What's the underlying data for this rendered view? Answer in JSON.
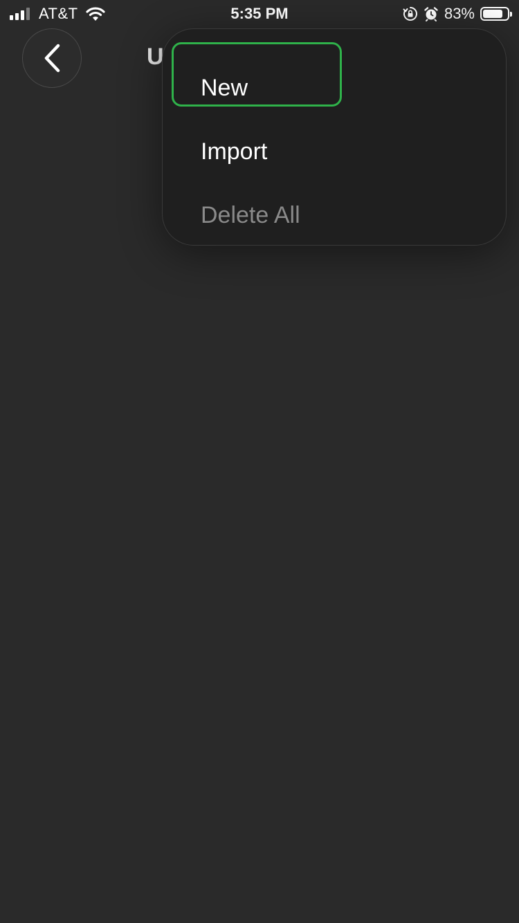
{
  "status_bar": {
    "carrier": "AT&T",
    "time": "5:35 PM",
    "battery_percent": "83%",
    "battery_level": 0.83,
    "signal_bars_active": 3,
    "signal_bars_total": 4,
    "icons": [
      "signal-icon",
      "wifi-icon",
      "orientation-lock-icon",
      "alarm-icon",
      "battery-icon"
    ]
  },
  "header": {
    "title": "U",
    "back_icon": "chevron-left-icon"
  },
  "menu": {
    "items": [
      {
        "label": "New",
        "enabled": true,
        "focused": true
      },
      {
        "label": "Import",
        "enabled": true,
        "focused": false
      },
      {
        "label": "Delete All",
        "enabled": false,
        "focused": false
      }
    ]
  },
  "colors": {
    "background": "#2a2a2a",
    "menu_background": "#1f1f1f",
    "focus_ring": "#2fb24a",
    "disabled_text": "#8a8a8a"
  }
}
